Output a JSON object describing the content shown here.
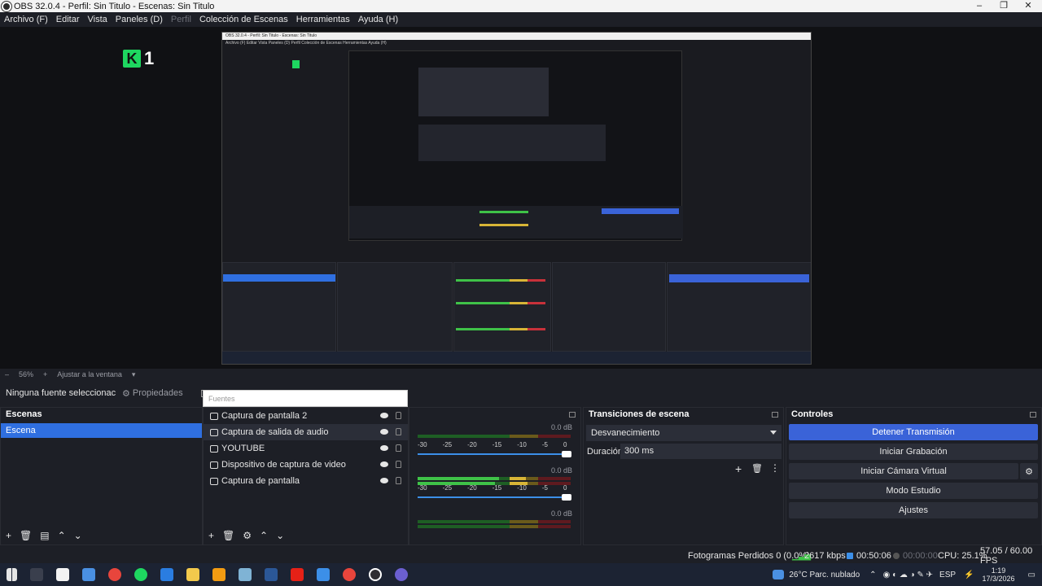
{
  "window": {
    "title": "OBS 32.0.4 - Perfil: Sin Titulo - Escenas: Sin Titulo",
    "minimize": "–",
    "maximize": "❐",
    "close": "✕"
  },
  "menu": {
    "items": [
      "Archivo (F)",
      "Editar",
      "Vista",
      "Paneles (D)",
      "Perfil",
      "Colección de Escenas",
      "Herramientas",
      "Ayuda (H)"
    ]
  },
  "preview": {
    "logo_letter": "K",
    "logo_number": "1",
    "capture_title": "OBS 32.0.4 - Perfil: Sin Titulo - Escenas: Sin Titulo",
    "capture_menu": "Archivo (F)   Editar   Vista   Paneles (D)   Perfil   Colección de Escenas   Herramientas   Ayuda (H)"
  },
  "zoom": {
    "minus": "–",
    "level": "56%",
    "plus": "+",
    "fit": "Ajustar a la ventana",
    "caret": "▾"
  },
  "source_toolbar": {
    "no_source": "Ninguna fuente seleccionac",
    "properties": "Propiedades",
    "filter_placeholder": "Fuentes"
  },
  "scenes": {
    "title": "Escenas",
    "items": [
      "Escena"
    ]
  },
  "sources": {
    "items": [
      {
        "label": "Captura de pantalla 2",
        "icon": "monitor-icon"
      },
      {
        "label": "Captura de salida de audio",
        "icon": "speaker-icon"
      },
      {
        "label": "YOUTUBE",
        "icon": "browser-icon"
      },
      {
        "label": "Dispositivo de captura de video",
        "icon": "camera-icon"
      },
      {
        "label": "Captura de pantalla",
        "icon": "monitor-icon"
      }
    ]
  },
  "mixer": {
    "db": [
      "0.0 dB",
      "0.0 dB",
      "0.0 dB"
    ],
    "ticks": [
      "-30",
      "-25",
      "-20",
      "-15",
      "-10",
      "-5",
      "0"
    ]
  },
  "transitions": {
    "title": "Transiciones de escena",
    "selected": "Desvanecimiento",
    "duration_label": "Duración",
    "duration_value": "300 ms"
  },
  "controls": {
    "title": "Controles",
    "stop_stream": "Detener Transmisión",
    "start_record": "Iniciar Grabación",
    "virtual_camera": "Iniciar Cámara Virtual",
    "studio_mode": "Modo Estudio",
    "settings": "Ajustes"
  },
  "status": {
    "dropped_frames": "Fotogramas Perdidos 0 (0.0%)",
    "bitrate": "2617 kbps",
    "stream_time": "00:50:06",
    "record_time": "00:00:00",
    "cpu": "CPU: 25.1%",
    "fps": "57.05 / 60.00 FPS"
  },
  "taskbar": {
    "weather": "26°C  Parc. nublado",
    "lang": "ESP",
    "time": "1:19",
    "date": "17/3/2026"
  },
  "colors": {
    "accent": "#3a63d8",
    "scene_selected": "#2f6fe0",
    "meter_green": "#3fc248",
    "meter_yellow": "#d8b536",
    "meter_red": "#c8313a"
  }
}
